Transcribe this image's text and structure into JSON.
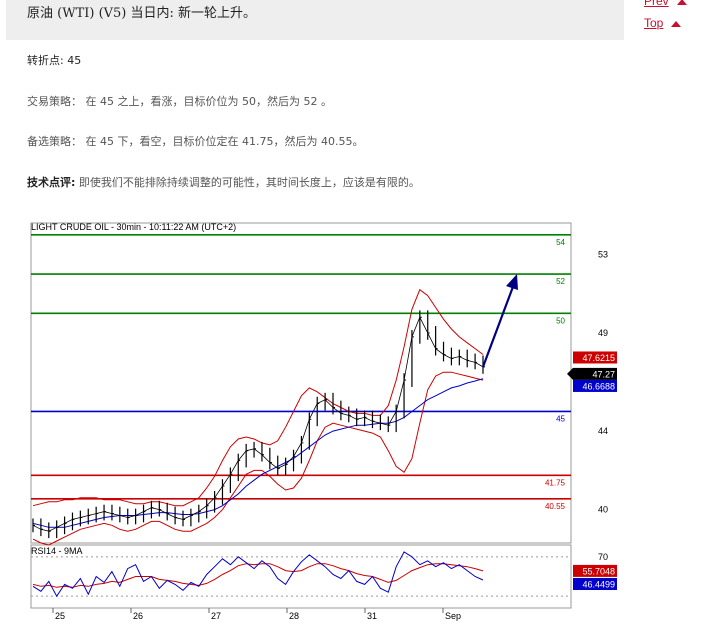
{
  "header": {
    "title": "原油 (WTI) (V5) 当日内: 新一轮上升。"
  },
  "nav": {
    "prev_label": "Prev",
    "top_label": "Top"
  },
  "article": {
    "pivot": {
      "label": "转折点:",
      "value": "45"
    },
    "strategy": {
      "label": "交易策略：",
      "text": "在 45 之上，看涨，目标价位为 50，然后为 52 。"
    },
    "alternative": {
      "label": "备选策略：",
      "text": "在 45 下，看空，目标价位定在 41.75，然后为 40.55。"
    },
    "comment": {
      "label": "技术点评:",
      "text": "即使我们不能排除持续调整的可能性，其时间长度上，应该是有限的。"
    }
  },
  "chart_data": {
    "type": "line",
    "title": "LIGHT CRUDE OIL - 30min - 10:11:22 AM (UTC+2)",
    "x_ticks": [
      "25",
      "26",
      "27",
      "28",
      "31",
      "Sep"
    ],
    "y_ticks": [
      40,
      44,
      49,
      53
    ],
    "ylim": [
      38.3,
      54.6
    ],
    "levels": [
      {
        "value": 54,
        "label": "54",
        "color": "#008000"
      },
      {
        "value": 52,
        "label": "52",
        "color": "#008000"
      },
      {
        "value": 50,
        "label": "50",
        "color": "#008000"
      },
      {
        "value": 45,
        "label": "45",
        "color": "#0000cc"
      },
      {
        "value": 41.75,
        "label": "41.75",
        "color": "#cc0000"
      },
      {
        "value": 40.55,
        "label": "40.55",
        "color": "#cc0000"
      }
    ],
    "price_series": [
      39.2,
      39.0,
      38.9,
      39.1,
      39.3,
      39.5,
      39.6,
      39.7,
      39.8,
      39.9,
      39.8,
      39.7,
      39.6,
      39.7,
      39.9,
      40.1,
      40.0,
      39.8,
      39.6,
      39.5,
      39.7,
      39.9,
      40.2,
      40.6,
      41.2,
      41.8,
      42.5,
      43.0,
      43.1,
      42.8,
      42.4,
      42.1,
      42.3,
      42.7,
      43.4,
      44.6,
      45.4,
      45.6,
      45.2,
      44.9,
      44.8,
      44.6,
      44.7,
      44.5,
      44.4,
      44.3,
      45.0,
      46.6,
      48.8,
      49.8,
      49.0,
      48.2,
      47.9,
      47.7,
      47.8,
      47.6,
      47.5,
      47.27
    ],
    "ma_series": [
      39.3,
      39.2,
      39.1,
      39.1,
      39.1,
      39.2,
      39.3,
      39.4,
      39.5,
      39.6,
      39.65,
      39.7,
      39.7,
      39.7,
      39.75,
      39.8,
      39.85,
      39.85,
      39.8,
      39.75,
      39.75,
      39.8,
      39.9,
      40.0,
      40.2,
      40.5,
      40.8,
      41.2,
      41.5,
      41.8,
      42.0,
      42.2,
      42.4,
      42.6,
      42.9,
      43.2,
      43.5,
      43.8,
      44.0,
      44.1,
      44.2,
      44.3,
      44.3,
      44.35,
      44.4,
      44.4,
      44.5,
      44.7,
      45.0,
      45.3,
      45.6,
      45.8,
      46.0,
      46.2,
      46.3,
      46.45,
      46.55,
      46.67
    ],
    "band_upper": [
      40.2,
      40.3,
      40.4,
      40.4,
      40.5,
      40.5,
      40.6,
      40.6,
      40.6,
      40.5,
      40.5,
      40.5,
      40.4,
      40.3,
      40.3,
      40.4,
      40.4,
      40.3,
      40.2,
      40.2,
      40.4,
      40.6,
      41.1,
      41.7,
      42.5,
      43.2,
      43.6,
      43.7,
      43.6,
      43.4,
      43.3,
      43.5,
      44.2,
      45.0,
      45.8,
      46.2,
      46.0,
      45.7,
      45.4,
      45.2,
      45.0,
      44.9,
      44.9,
      44.8,
      44.8,
      45.3,
      46.6,
      48.3,
      50.2,
      51.2,
      50.9,
      50.3,
      49.7,
      49.2,
      48.8,
      48.5,
      48.2,
      47.9
    ],
    "band_lower": [
      38.5,
      38.3,
      38.2,
      38.4,
      38.6,
      38.8,
      39.0,
      39.1,
      39.2,
      39.3,
      39.2,
      39.0,
      38.9,
      39.0,
      39.2,
      39.4,
      39.4,
      39.2,
      39.0,
      38.9,
      38.9,
      39.1,
      39.3,
      39.6,
      40.0,
      40.6,
      41.2,
      41.8,
      42.0,
      42.0,
      41.7,
      41.3,
      41.0,
      41.1,
      41.6,
      42.5,
      43.5,
      44.2,
      44.4,
      44.3,
      44.2,
      44.1,
      44.0,
      43.9,
      43.7,
      43.0,
      42.2,
      41.9,
      42.6,
      44.4,
      46.1,
      46.8,
      47.0,
      47.0,
      46.9,
      46.8,
      46.7,
      46.6
    ],
    "projection": {
      "from": 47.27,
      "to": 52.0
    },
    "labels": {
      "upper": {
        "value": "47.6215",
        "color": "#cc0000"
      },
      "last": {
        "value": "47.27",
        "color": "#000000"
      },
      "lower": {
        "value": "46.6688",
        "color": "#0000cc"
      }
    },
    "rsi": {
      "title": "RSI14 - 9MA",
      "ylim": [
        20,
        80
      ],
      "y_ticks": [
        70
      ],
      "rsi_series": [
        40,
        35,
        45,
        30,
        42,
        38,
        48,
        32,
        50,
        44,
        55,
        40,
        58,
        62,
        45,
        50,
        38,
        46,
        42,
        36,
        44,
        40,
        52,
        60,
        68,
        62,
        70,
        64,
        58,
        66,
        60,
        48,
        42,
        55,
        65,
        72,
        66,
        60,
        52,
        48,
        56,
        45,
        42,
        50,
        38,
        34,
        60,
        75,
        70,
        62,
        66,
        60,
        64,
        58,
        62,
        56,
        50,
        46.45
      ],
      "ma_series": [
        42,
        40,
        41,
        39,
        40,
        39,
        41,
        40,
        42,
        43,
        45,
        44,
        47,
        50,
        50,
        50,
        47,
        46,
        45,
        43,
        42,
        41,
        43,
        47,
        52,
        56,
        61,
        63,
        62,
        63,
        63,
        60,
        56,
        55,
        56,
        60,
        63,
        63,
        61,
        58,
        56,
        53,
        51,
        50,
        47,
        44,
        46,
        51,
        56,
        59,
        62,
        63,
        63,
        62,
        61,
        60,
        58,
        55.7
      ],
      "ma_label": {
        "value": "55.7048",
        "color": "#cc0000"
      },
      "rsi_label": {
        "value": "46.4499",
        "color": "#0000cc"
      }
    }
  }
}
